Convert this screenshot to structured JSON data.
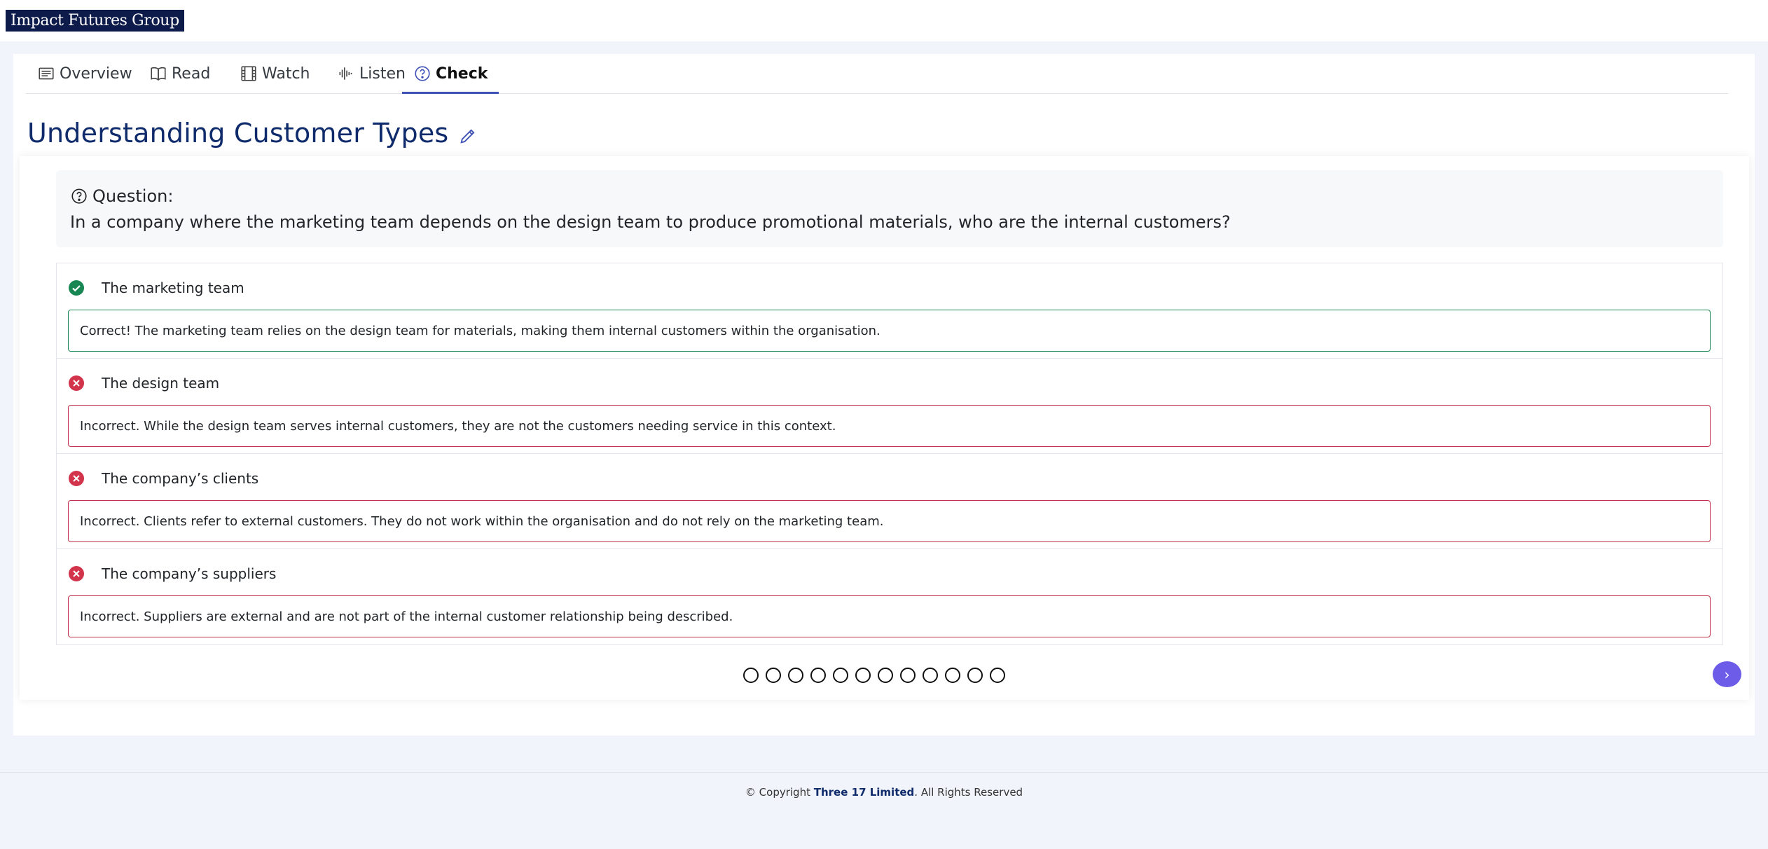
{
  "header": {
    "logo_text": "Impact Futures Group"
  },
  "tabs": [
    {
      "label": "Overview",
      "icon": "list-icon"
    },
    {
      "label": "Read",
      "icon": "book-icon"
    },
    {
      "label": "Watch",
      "icon": "film-icon"
    },
    {
      "label": "Listen",
      "icon": "audio-wave-icon"
    },
    {
      "label": "Check",
      "icon": "question-circle-icon",
      "active": true
    }
  ],
  "page": {
    "title": "Understanding Customer Types"
  },
  "question": {
    "label": "Question:",
    "text": "In a company where the marketing team depends on the design team to produce promotional materials, who are the internal customers?"
  },
  "answers": [
    {
      "label": "The marketing team",
      "status": "correct",
      "feedback": "Correct! The marketing team relies on the design team for materials, making them internal customers within the organisation."
    },
    {
      "label": "The design team",
      "status": "incorrect",
      "feedback": "Incorrect. While the design team serves internal customers, they are not the customers needing service in this context."
    },
    {
      "label": "The company’s clients",
      "status": "incorrect",
      "feedback": "Incorrect. Clients refer to external customers. They do not work within the organisation and do not rely on the marketing team."
    },
    {
      "label": "The company’s suppliers",
      "status": "incorrect",
      "feedback": "Incorrect. Suppliers are external and are not part of the internal customer relationship being described."
    }
  ],
  "pagination": {
    "count": 12,
    "next_label": "›"
  },
  "footer": {
    "prefix": "© Copyright ",
    "company": "Three 17 Limited",
    "suffix": ". All Rights Reserved"
  },
  "colors": {
    "correct": "#198754",
    "incorrect": "#c4314b",
    "accent": "#3f51b5",
    "title": "#0f2b6b",
    "next_button": "#6c5ce7"
  }
}
